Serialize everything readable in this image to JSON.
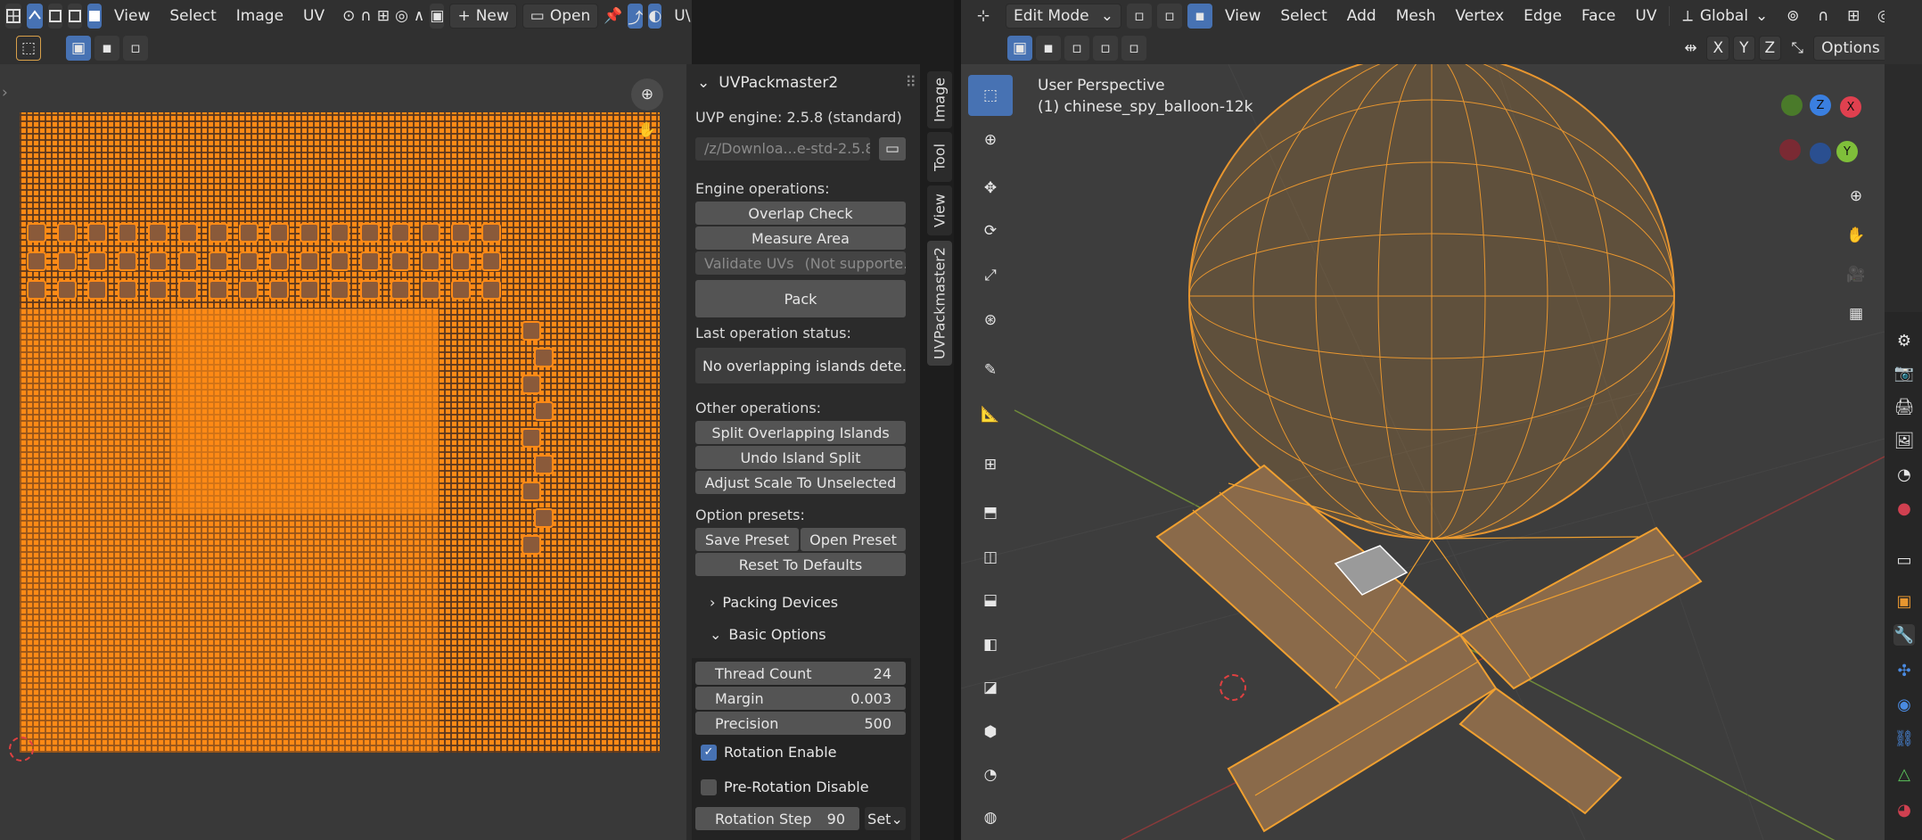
{
  "uv_header": {
    "menus": [
      "View",
      "Select",
      "Image",
      "UV"
    ],
    "new_label": "New",
    "open_label": "Open",
    "truncated": "U\\"
  },
  "viewport_header": {
    "mode": "Edit Mode",
    "menus": [
      "View",
      "Select",
      "Add",
      "Mesh",
      "Vertex",
      "Edge",
      "Face",
      "UV"
    ],
    "transform_orientation": "Global",
    "axes": [
      "X",
      "Y",
      "Z"
    ],
    "options_label": "Options"
  },
  "panel": {
    "title": "UVPackmaster2",
    "engine_version": "UVP engine: 2.5.8 (standard)",
    "engine_path": "/z/Downloa...e-std-2.5.8",
    "engine_ops_label": "Engine operations:",
    "overlap_check": "Overlap Check",
    "measure_area": "Measure Area",
    "validate_uvs": "Validate UVs",
    "validate_note": "(Not supporte...",
    "pack": "Pack",
    "last_status_label": "Last operation status:",
    "last_status": "No overlapping islands dete...",
    "other_ops_label": "Other operations:",
    "split_overlapping": "Split Overlapping Islands",
    "undo_split": "Undo Island Split",
    "adjust_scale": "Adjust Scale To Unselected",
    "option_presets_label": "Option presets:",
    "save_preset": "Save Preset",
    "open_preset": "Open Preset",
    "reset_defaults": "Reset To Defaults",
    "packing_devices": "Packing Devices",
    "basic_options": "Basic Options",
    "thread_count_label": "Thread Count",
    "thread_count": "24",
    "margin_label": "Margin",
    "margin": "0.003",
    "precision_label": "Precision",
    "precision": "500",
    "rotation_enable": "Rotation Enable",
    "rotation_enable_checked": true,
    "pre_rotation_disable": "Pre-Rotation Disable",
    "pre_rotation_checked": false,
    "rotation_step_label": "Rotation Step",
    "rotation_step": "90",
    "set_label": "Set"
  },
  "side_tabs": [
    "Image",
    "Tool",
    "View",
    "UVPackmaster2"
  ],
  "viewport": {
    "perspective": "User Perspective",
    "object": "(1) chinese_spy_balloon-12k"
  },
  "colors": {
    "accent": "#4772b3",
    "uv_orange": "#ff8a16",
    "wire_orange": "#e8962f",
    "gizmo_x": "#e0404f",
    "gizmo_y": "#7fbf3a",
    "gizmo_z": "#3a7fe0"
  }
}
